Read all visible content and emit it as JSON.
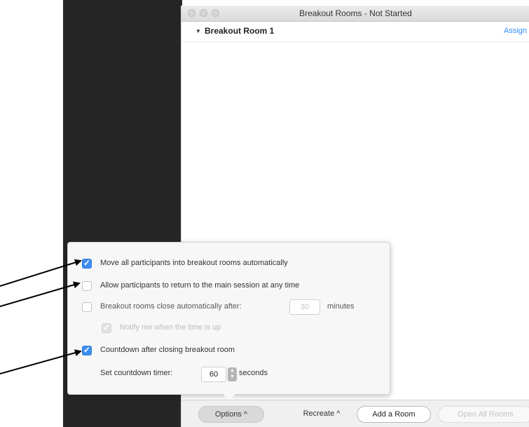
{
  "window": {
    "title": "Breakout Rooms - Not Started"
  },
  "rooms": [
    {
      "name": "Breakout Room 1",
      "assign_label": "Assign"
    }
  ],
  "options": {
    "move_auto": {
      "label": "Move all participants into breakout rooms automatically",
      "checked": true
    },
    "allow_return": {
      "label": "Allow participants to return to the main session at any time",
      "checked": false
    },
    "auto_close": {
      "label": "Breakout rooms close automatically after:",
      "checked": false,
      "minutes_value": "30",
      "minutes_unit": "minutes"
    },
    "notify": {
      "label": "Notify me when the time is up",
      "checked": true,
      "disabled": true
    },
    "countdown": {
      "label": "Countdown after closing breakout room",
      "checked": true
    },
    "timer": {
      "label": "Set countdown timer:",
      "value": "60",
      "unit": "seconds"
    }
  },
  "bottom_bar": {
    "options_label": "Options ^",
    "recreate_label": "Recreate ^",
    "add_room_label": "Add a Room",
    "open_all_label": "Open All Rooms"
  },
  "colors": {
    "accent": "#2d8cff",
    "checkbox_blue": "#3d8ef0",
    "sidebar_dark": "#262626"
  }
}
